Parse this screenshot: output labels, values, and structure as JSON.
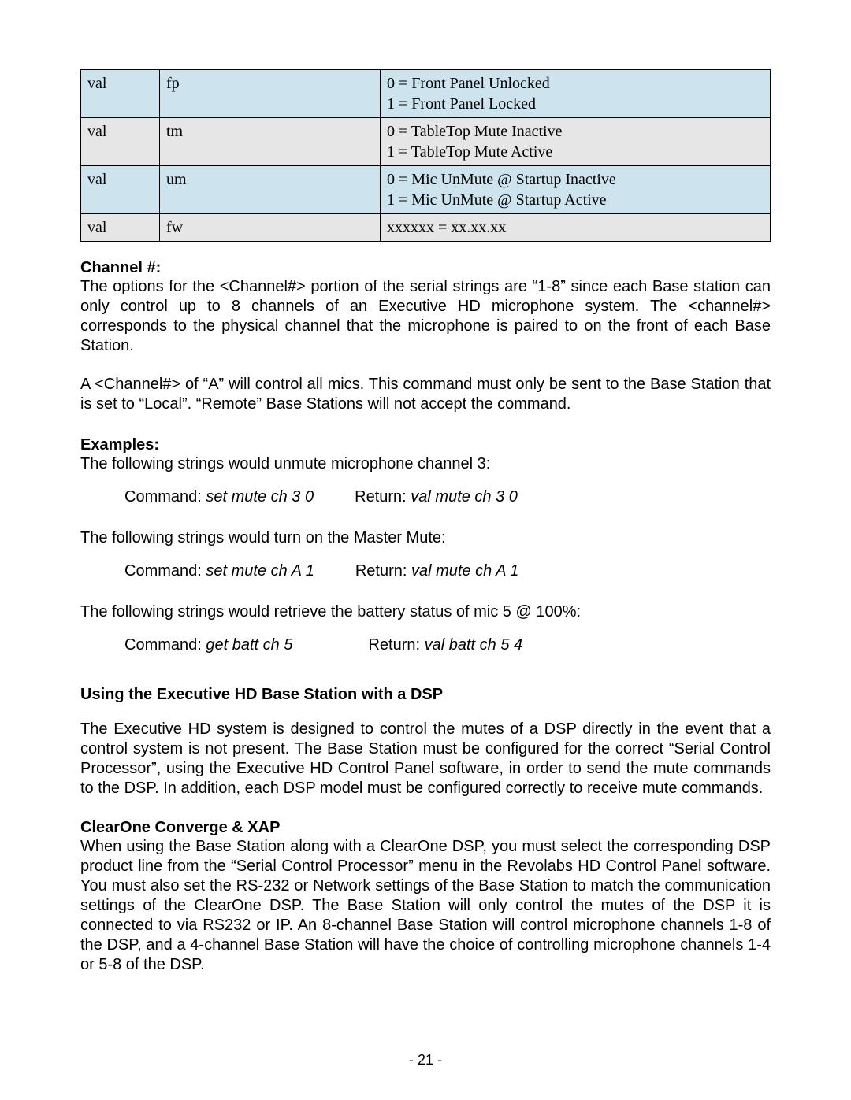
{
  "table": {
    "rows": [
      {
        "c0": "val",
        "c1": "fp",
        "c2": "0 = Front Panel Unlocked\n1 = Front Panel Locked",
        "cls": "blue"
      },
      {
        "c0": "val",
        "c1": "tm",
        "c2": "0 = TableTop Mute Inactive\n1 = TableTop Mute Active",
        "cls": "grey"
      },
      {
        "c0": "val",
        "c1": "um",
        "c2": "0 = Mic UnMute @ Startup Inactive\n1 = Mic UnMute @ Startup Active",
        "cls": "blue"
      },
      {
        "c0": "val",
        "c1": "fw",
        "c2": "xxxxxx = xx.xx.xx",
        "cls": "grey"
      }
    ]
  },
  "channel": {
    "heading": "Channel #:",
    "p1": "The options for the <Channel#> portion of the serial strings are “1-8” since each Base station can only control up to 8 channels of an Executive HD microphone system. The <channel#> corresponds to the physical channel that the microphone is paired to on the front of each Base Station.",
    "p2": "A <Channel#> of “A” will control all mics. This command must only be sent to the Base Station that is set to “Local”. “Remote” Base Stations will not accept the command."
  },
  "examples": {
    "heading": "Examples:",
    "intro1": "The following strings would unmute microphone channel 3:",
    "ex1": {
      "cmd_label": "Command:  ",
      "cmd": "set mute ch 3 0",
      "ret_label": "Return:  ",
      "ret": "val mute ch 3 0"
    },
    "intro2": "The following strings would turn on the Master Mute:",
    "ex2": {
      "cmd_label": "Command:  ",
      "cmd": "set mute ch A 1",
      "ret_label": "Return:  ",
      "ret": "val mute ch A 1"
    },
    "intro3": "The following strings would retrieve the battery status of mic 5 @ 100%:",
    "ex3": {
      "cmd_label": "Command:  ",
      "cmd": "get batt ch 5",
      "ret_label": "Return:  ",
      "ret": "val batt ch 5 4"
    }
  },
  "dsp": {
    "heading": "Using the Executive HD Base Station with a DSP",
    "p1": "The Executive HD system is designed to control the mutes of a DSP directly in the event that a control system is not present. The Base Station must be configured for the correct “Serial Control Processor”, using the Executive HD Control Panel software, in order to send the mute commands to the DSP. In addition, each DSP model must be configured correctly to receive mute commands."
  },
  "clearone": {
    "heading": "ClearOne Converge & XAP",
    "p1": "When using the Base Station along with a ClearOne DSP, you must select the corresponding DSP product line from the “Serial Control Processor” menu in the Revolabs HD Control Panel software. You must also set the RS-232 or Network settings of the Base Station to match the communication settings of the ClearOne DSP. The Base Station will only control the mutes of the DSP it is connected to via RS232 or IP. An 8-channel Base Station will control microphone channels 1-8 of the DSP, and a 4-channel Base Station will have the choice of controlling microphone channels 1-4 or 5-8 of the DSP."
  },
  "page_number": "- 21 -"
}
